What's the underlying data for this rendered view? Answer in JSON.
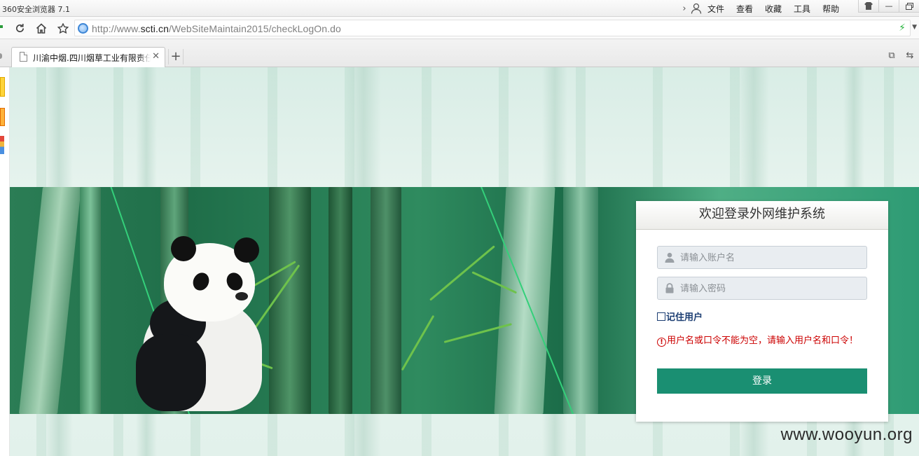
{
  "titlebar": {
    "app_title": "360安全浏览器 7.1",
    "menu": [
      "文件",
      "查看",
      "收藏",
      "工具",
      "帮助"
    ]
  },
  "navbar": {
    "url_prefix": "http://www.",
    "url_host": "scti.cn",
    "url_path": "/WebSiteMaintain2015/checkLogOn.do"
  },
  "tabs": [
    {
      "title": "川渝中烟.四川烟草工业有限责任公司",
      "active": true
    }
  ],
  "login": {
    "title": "欢迎登录外网维护系统",
    "username_placeholder": "请输入账户名",
    "password_placeholder": "请输入密码",
    "remember_label": "记住用户",
    "error_message": "用户名或口令不能为空，请输入用户名和口令！",
    "submit_label": "登录"
  },
  "watermark": "www.wooyun.org",
  "colors": {
    "banner_green": "#1f6e49",
    "button": "#1a8f72",
    "error": "#cc0000",
    "remember_text": "#1b3d72"
  }
}
